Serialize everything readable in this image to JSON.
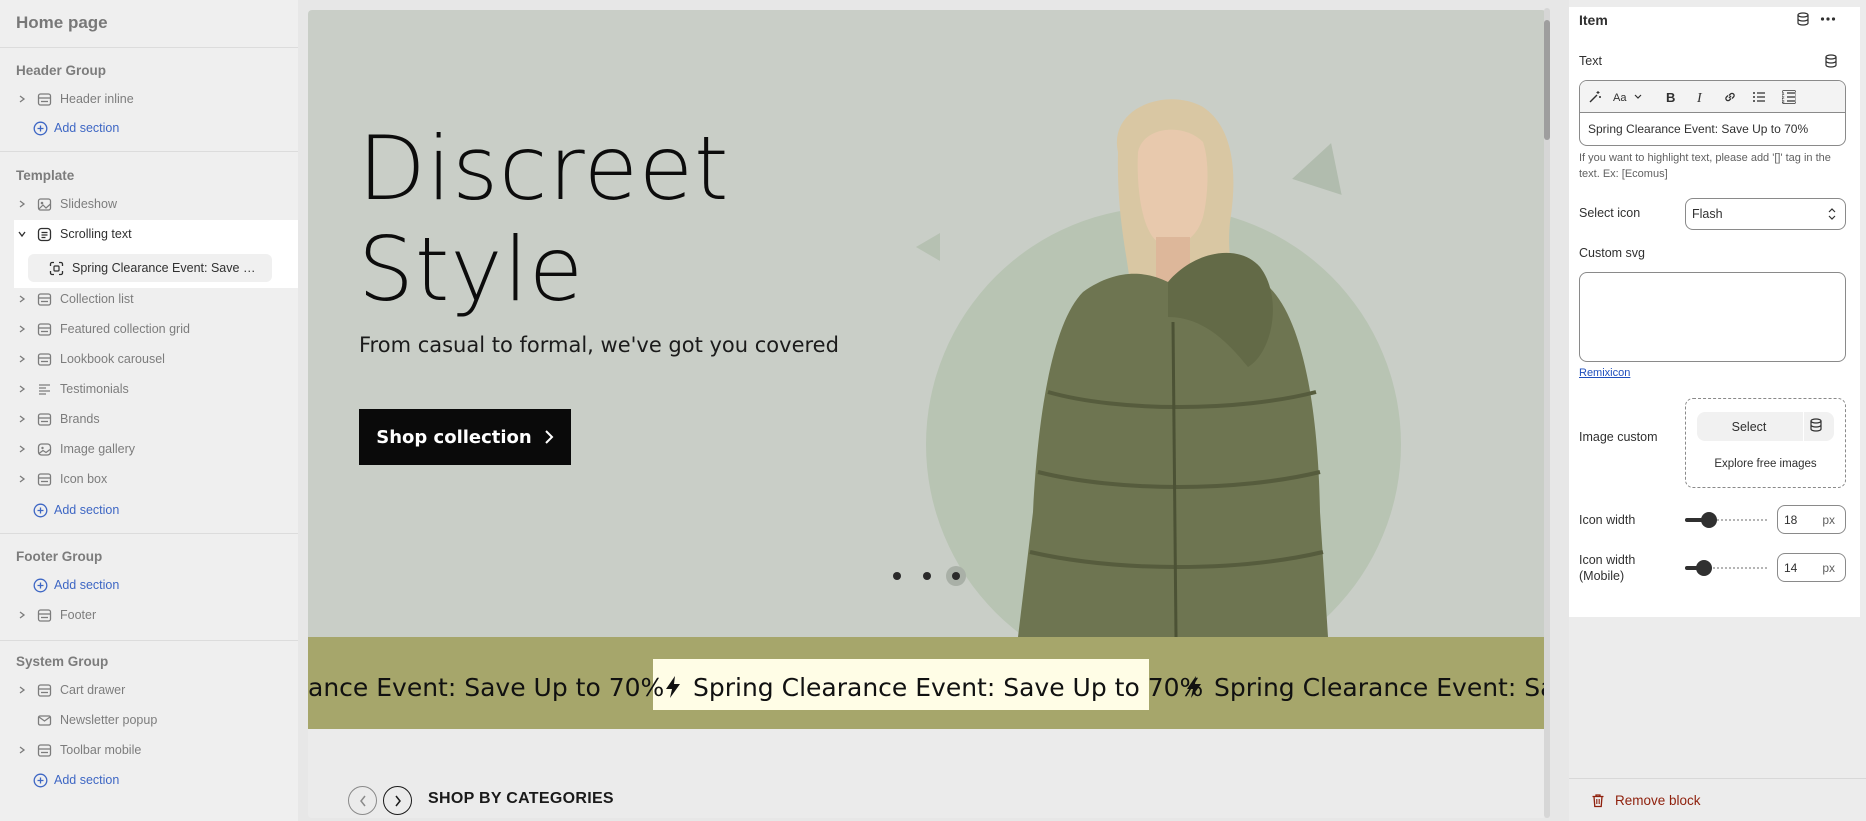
{
  "sidebar": {
    "title": "Home page",
    "groups": {
      "header": {
        "label": "Header Group",
        "items": [
          {
            "label": "Header inline",
            "icon": "section-table-icon"
          }
        ],
        "add_label": "Add section"
      },
      "template": {
        "label": "Template",
        "items": [
          {
            "label": "Slideshow",
            "icon": "slideshow-icon"
          },
          {
            "label": "Scrolling text",
            "icon": "scrolling-text-icon",
            "expanded": true,
            "children": [
              {
                "label": "Spring Clearance Event: Save U...",
                "icon": "block-icon",
                "selected": true
              }
            ]
          },
          {
            "label": "Collection list",
            "icon": "section-table-icon"
          },
          {
            "label": "Featured collection grid",
            "icon": "section-table-icon"
          },
          {
            "label": "Lookbook carousel",
            "icon": "section-table-icon"
          },
          {
            "label": "Testimonials",
            "icon": "list-icon"
          },
          {
            "label": "Brands",
            "icon": "section-table-icon"
          },
          {
            "label": "Image gallery",
            "icon": "image-gallery-icon"
          },
          {
            "label": "Icon box",
            "icon": "section-table-icon"
          }
        ],
        "add_label": "Add section"
      },
      "footer": {
        "label": "Footer Group",
        "add_label": "Add section",
        "items": [
          {
            "label": "Footer",
            "icon": "section-table-icon"
          }
        ]
      },
      "system": {
        "label": "System Group",
        "items": [
          {
            "label": "Cart drawer",
            "icon": "section-table-icon"
          },
          {
            "label": "Newsletter popup",
            "icon": "mail-icon"
          },
          {
            "label": "Toolbar mobile",
            "icon": "section-table-icon"
          }
        ],
        "add_label": "Add section"
      }
    }
  },
  "preview": {
    "hero": {
      "heading": "Discreet\nStyle",
      "subheading": "From casual to formal, we've got you covered",
      "button_label": "Shop collection",
      "slide_count": 3,
      "active_slide": 3
    },
    "marquee": {
      "text": "Spring Clearance Event: Save Up to 70%",
      "partial_left": "ance Event: Save Up to 70%",
      "partial_right": "Spring Clearance Event: Save",
      "icon": "flash-icon",
      "background": "#a6a66b",
      "highlight": "#fffde6"
    },
    "categories": {
      "title": "SHOP BY CATEGORIES"
    }
  },
  "panel": {
    "title": "Item",
    "text_label": "Text",
    "text_value": "Spring Clearance Event: Save Up to 70%",
    "help_text": "If you want to highlight text, please add '[]' tag in the text. Ex: [Ecomus]",
    "select_icon_label": "Select icon",
    "select_icon_value": "Flash",
    "custom_svg_label": "Custom svg",
    "custom_svg_value": "",
    "remixicon_link": "Remixicon",
    "image_custom_label": "Image custom",
    "image_select_label": "Select",
    "explore_label": "Explore free images",
    "icon_width_label": "Icon width",
    "icon_width_value": "18",
    "icon_width_mobile_label": "Icon width (Mobile)",
    "icon_width_mobile_value": "14",
    "unit": "px",
    "remove_label": "Remove block",
    "colors": {
      "danger": "#8e1f0b",
      "link": "#1f4fbd"
    }
  }
}
